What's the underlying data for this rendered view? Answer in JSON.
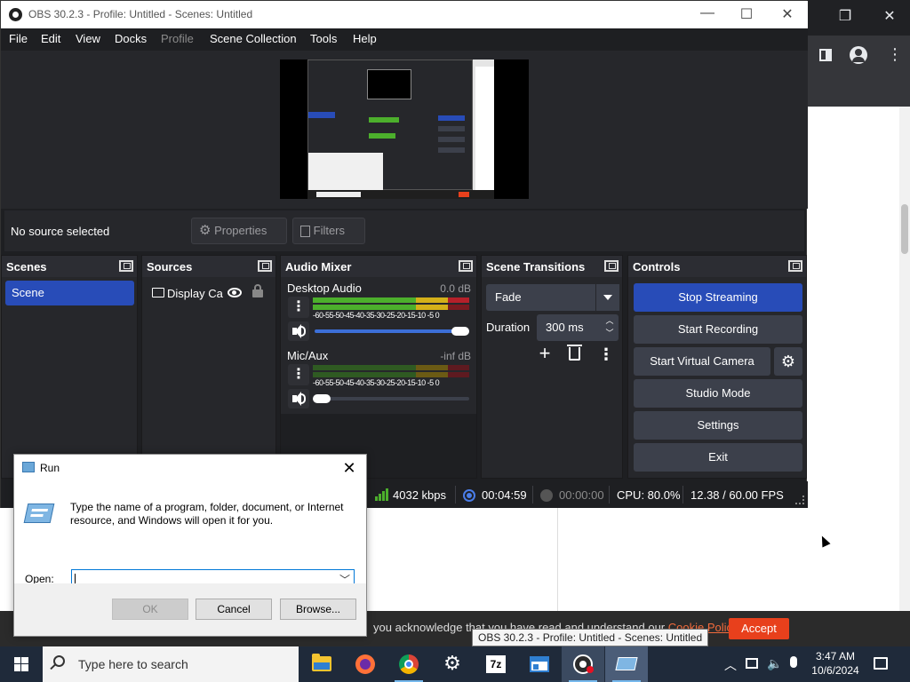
{
  "obs": {
    "title": "OBS 30.2.3 - Profile: Untitled - Scenes: Untitled",
    "menu": [
      "File",
      "Edit",
      "View",
      "Docks",
      "Profile",
      "Scene Collection",
      "Tools",
      "Help"
    ],
    "source_bar": {
      "no_source": "No source selected",
      "properties_label": "Properties",
      "filters_label": "Filters"
    },
    "docks": {
      "scenes": {
        "title": "Scenes",
        "items": [
          "Scene"
        ]
      },
      "sources": {
        "title": "Sources",
        "items": [
          "Display Capture"
        ]
      },
      "mixer": {
        "title": "Audio Mixer",
        "tracks": [
          {
            "name": "Desktop Audio",
            "db": "0.0 dB",
            "volume": 1.0
          },
          {
            "name": "Mic/Aux",
            "db": "-inf dB",
            "volume": 0.0
          }
        ],
        "ticks": "-60-55-50-45-40-35-30-25-20-15-10 -5  0"
      },
      "transitions": {
        "title": "Scene Transitions",
        "selected": "Fade",
        "duration_label": "Duration",
        "duration_value": "300 ms"
      },
      "controls": {
        "title": "Controls",
        "stop_streaming": "Stop Streaming",
        "start_recording": "Start Recording",
        "start_virtual_camera": "Start Virtual Camera",
        "studio_mode": "Studio Mode",
        "settings": "Settings",
        "exit": "Exit"
      }
    },
    "status": {
      "bitrate": "4032 kbps",
      "stream_time": "00:04:59",
      "record_time": "00:00:00",
      "cpu": "CPU: 80.0%",
      "fps": "12.38 / 60.00 FPS"
    }
  },
  "run_dialog": {
    "title": "Run",
    "description": "Type the name of a program, folder, document, or Internet resource, and Windows will open it for you.",
    "open_label": "Open:",
    "open_value": "",
    "ok": "OK",
    "cancel": "Cancel",
    "browse": "Browse..."
  },
  "browser": {
    "cookie_text": "you acknowledge that you have read and understand our",
    "cookie_link": "Cookie Policy",
    "accept": "Accept"
  },
  "tooltip": "OBS 30.2.3 - Profile: Untitled - Scenes: Untitled",
  "taskbar": {
    "search_placeholder": "Type here to search",
    "time": "3:47 AM",
    "date": "10/6/2024"
  },
  "colors": {
    "obs_accent": "#284cb8",
    "meter_green": "#4caf2c",
    "meter_yellow": "#d4b019",
    "meter_red": "#b5202a",
    "accept_button": "#e8401c"
  }
}
